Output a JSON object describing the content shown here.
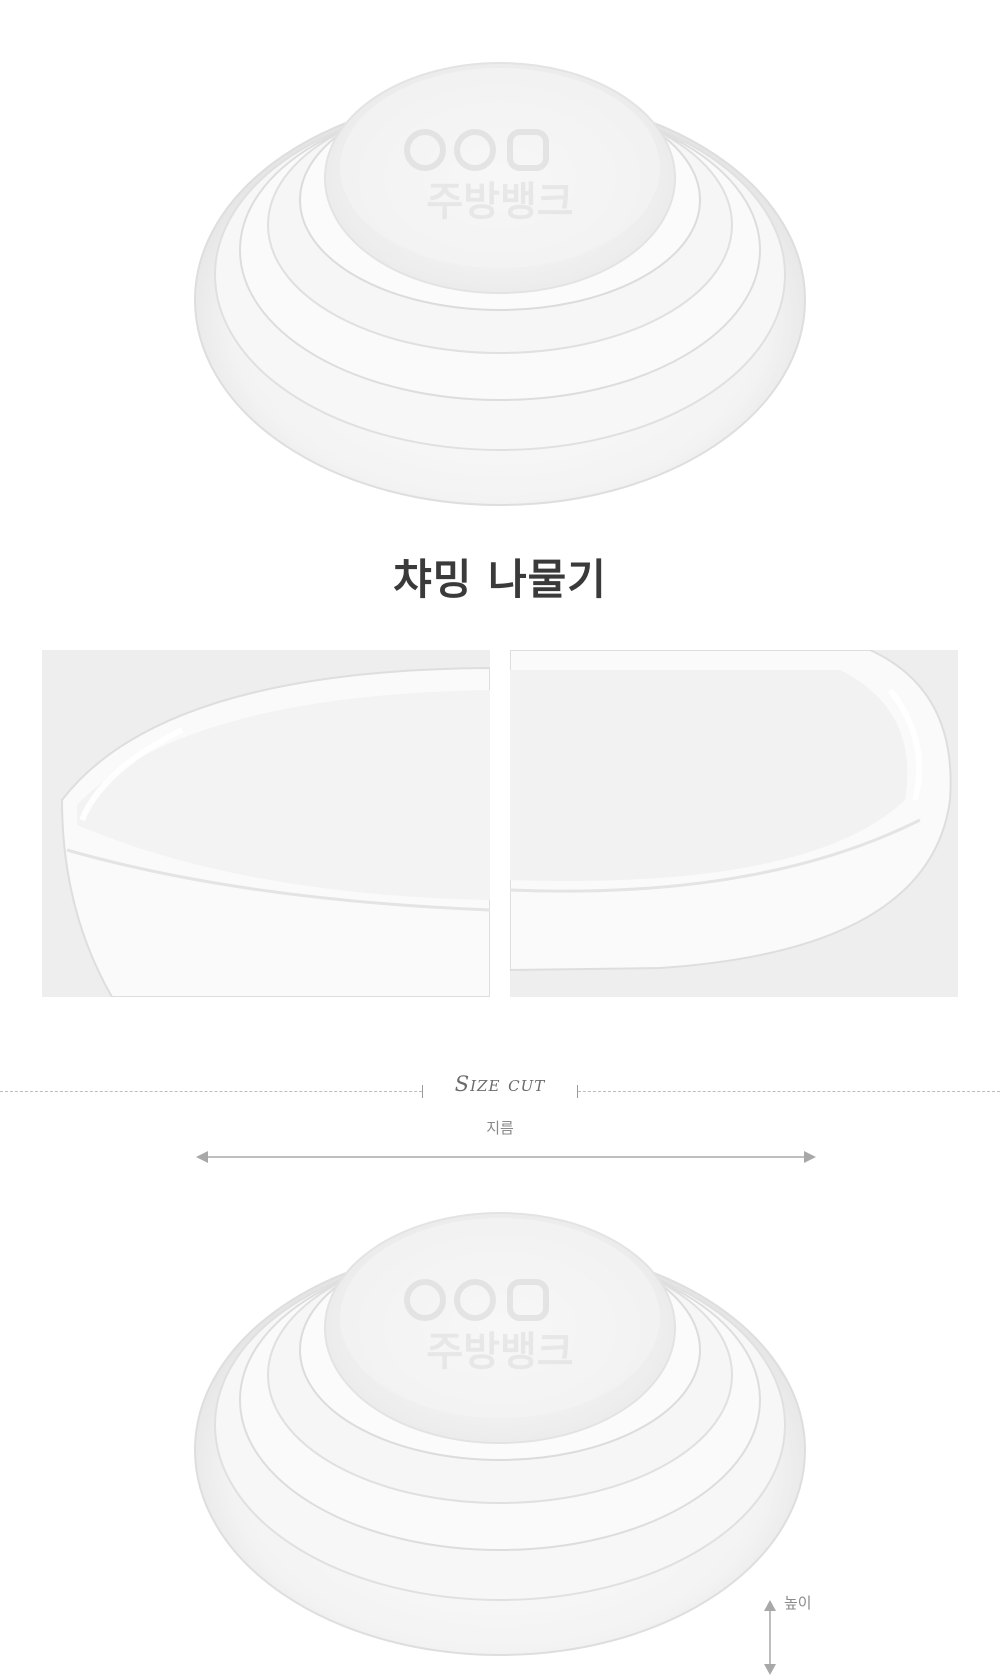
{
  "product": {
    "title": "챠밍 나물기"
  },
  "watermark": {
    "text": "주방뱅크"
  },
  "size_section": {
    "heading": "Size cut",
    "diameter_label": "지름",
    "height_label": "높이"
  },
  "colors": {
    "title_text": "#3a3a3a",
    "label_text": "#8a8a8a",
    "divider": "#bdbdbd",
    "detail_background": "#eeeeee",
    "dish_white": "#fbfbfb"
  }
}
